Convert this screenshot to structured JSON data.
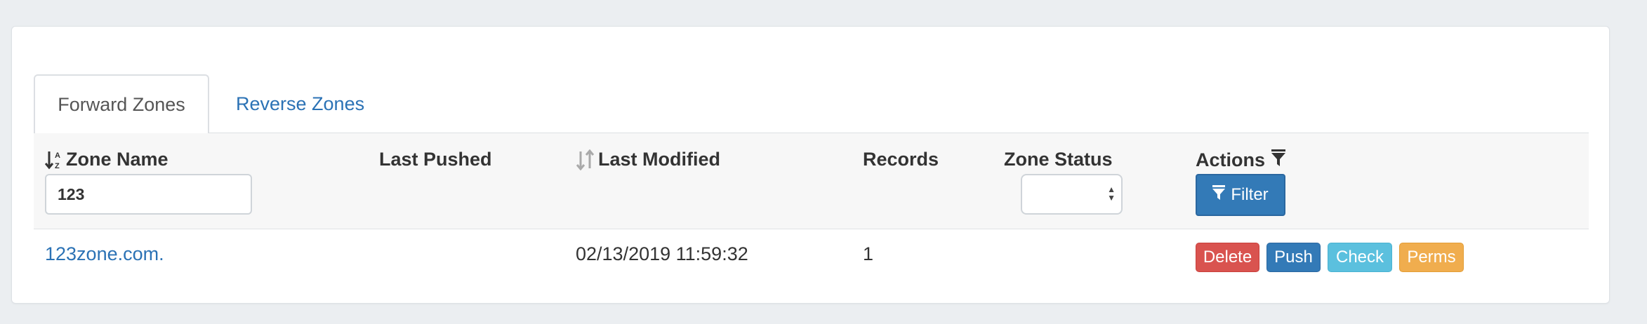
{
  "tabs": [
    {
      "label": "Forward Zones",
      "active": true
    },
    {
      "label": "Reverse Zones",
      "active": false
    }
  ],
  "columns": {
    "zone_name": "Zone Name",
    "last_pushed": "Last Pushed",
    "last_modified": "Last Modified",
    "records": "Records",
    "zone_status": "Zone Status",
    "actions": "Actions"
  },
  "filters": {
    "zone_name_value": "123",
    "zone_status_value": "",
    "filter_button": "Filter"
  },
  "rows": [
    {
      "zone_name": "123zone.com.",
      "last_pushed": "",
      "last_modified": "02/13/2019 11:59:32",
      "records": "1",
      "zone_status": "",
      "actions": [
        "Delete",
        "Push",
        "Check",
        "Perms"
      ]
    }
  ],
  "colors": {
    "link": "#2b72b5",
    "primary": "#337ab7",
    "danger": "#d9534f",
    "info": "#5bc0de",
    "warning": "#f0ad4e"
  },
  "icons": {
    "zone_name_sort": "sort-alpha-down-icon",
    "last_modified_sort": "sort-icon",
    "actions_filter": "funnel-icon",
    "filter_button": "funnel-icon"
  }
}
